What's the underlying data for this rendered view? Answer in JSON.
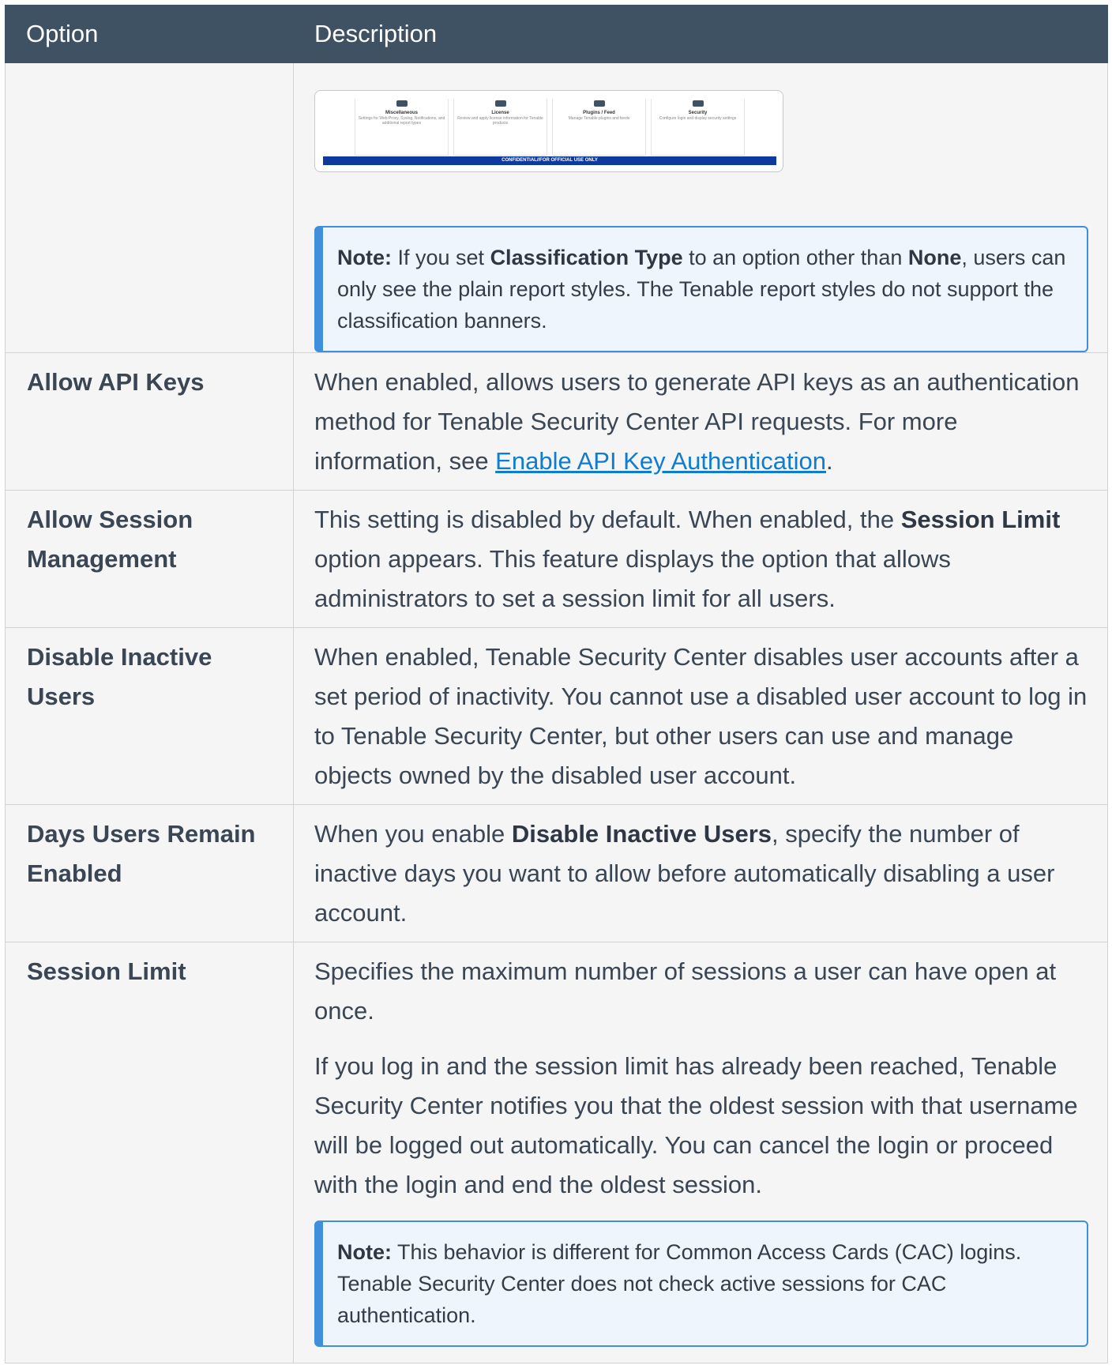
{
  "table": {
    "headers": {
      "option": "Option",
      "description": "Description"
    },
    "thumbnail": {
      "tiles": [
        {
          "icon": "miscellaneous-icon",
          "title": "Miscellaneous",
          "desc": "Settings for Web Proxy, Syslog, Notifications, and additional report types"
        },
        {
          "icon": "license-icon",
          "title": "License",
          "desc": "Review and apply license information for Tenable products"
        },
        {
          "icon": "plugins-feed-icon",
          "title": "Plugins / Feed",
          "desc": "Manage Tenable plugins and feeds"
        },
        {
          "icon": "security-icon",
          "title": "Security",
          "desc": "Configure login and display security settings"
        }
      ],
      "banner": "CONFIDENTIAL//FOR OFFICIAL USE ONLY"
    },
    "note1": {
      "label": "Note:",
      "t1": " If you set ",
      "b1": "Classification Type",
      "t2": " to an option other than ",
      "b2": "None",
      "t3": ", users can only see the plain report styles. The Tenable report styles do not support the classification banners."
    },
    "rows": {
      "api": {
        "option": "Allow API Keys",
        "t1": "When enabled, allows users to generate API keys as an authentication method for Tenable Security Center API requests. For more information, see ",
        "link": "Enable API Key Authentication",
        "t2": "."
      },
      "session_mgmt": {
        "option": "Allow Session Management",
        "t1": "This setting is disabled by default. When enabled, the ",
        "b1": "Session Limit",
        "t2": " option appears. This feature displays the option that allows administrators to set a session limit for all users."
      },
      "disable_inactive": {
        "option": "Disable Inactive Users",
        "text": "When enabled, Tenable Security Center disables user accounts after a set period of inactivity. You cannot use a disabled user account to log in to Tenable Security Center, but other users can use and manage objects owned by the disabled user account."
      },
      "days_enabled": {
        "option": "Days Users Remain Enabled",
        "t1": "When you enable ",
        "b1": "Disable Inactive Users",
        "t2": ", specify the number of inactive days you want to allow before automatically disabling a user account."
      },
      "session_limit": {
        "option": "Session Limit",
        "p1": "Specifies the maximum number of sessions a user can have open at once.",
        "p2": "If you log in and the session limit has already been reached, Tenable Security Center notifies you that the oldest session with that username will be logged out automatically. You can cancel the login or proceed with the login and end the oldest session.",
        "note_label": "Note:",
        "note_text": " This behavior is different for Common Access Cards (CAC) logins. Tenable Security Center does not check active sessions for CAC authentication."
      }
    }
  }
}
